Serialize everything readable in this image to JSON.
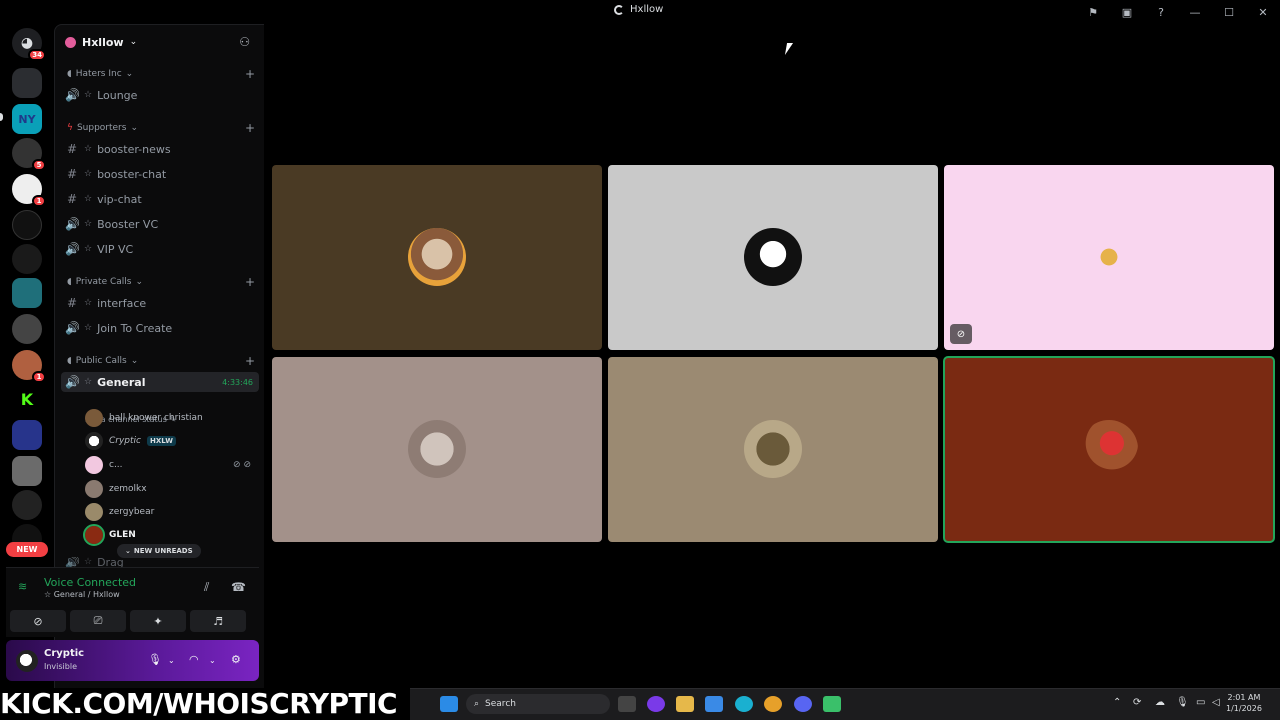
{
  "app": {
    "title": "Hxllow"
  },
  "guild": {
    "name": "Hxllow"
  },
  "rail_badges": {
    "home": "34",
    "server4": "5",
    "server5": "1",
    "server11": "1",
    "new": "NEW"
  },
  "categories": {
    "haters": "Haters Inc",
    "supporters": "Supporters",
    "private": "Private Calls",
    "public": "Public Calls"
  },
  "channels": {
    "lounge": "Lounge",
    "booster_news": "booster-news",
    "booster_chat": "booster-chat",
    "vip_chat": "vip-chat",
    "booster_vc": "Booster VC",
    "vip_vc": "VIP VC",
    "interface": "interface",
    "join_to_create": "Join To Create",
    "general": "General",
    "general_time": "4:33:46",
    "general_status": "Set a channel status",
    "drag": "Drag"
  },
  "voice_users": [
    {
      "name": "ball knower christian"
    },
    {
      "name": "Cryptic",
      "tag": "HXLW"
    },
    {
      "name": "c..."
    },
    {
      "name": "zemolkx"
    },
    {
      "name": "zergybear"
    },
    {
      "name": "GLEN"
    }
  ],
  "new_unreads": "NEW UNREADS",
  "voice": {
    "title": "Voice Connected",
    "location": "General / Hxllow"
  },
  "user": {
    "name": "Cryptic",
    "status": "Invisible"
  },
  "taskbar": {
    "banner": "KICK.COM/WHOISCRYPTIC",
    "search": "Search",
    "time": "2:01 AM",
    "date": "1/1/2026"
  },
  "colors": {
    "tile1": "#4a3a24",
    "tile2": "#c9c9c9",
    "tile3": "#f9d6ef",
    "tile4": "#a3918a",
    "tile5": "#9b8a72",
    "tile6": "#7a2a12",
    "speaking": "#23a55a",
    "brand": "#5865f2"
  },
  "icons": [
    "gear-icon",
    "mic-icon",
    "headphones-icon",
    "search-icon",
    "hangup-icon"
  ]
}
